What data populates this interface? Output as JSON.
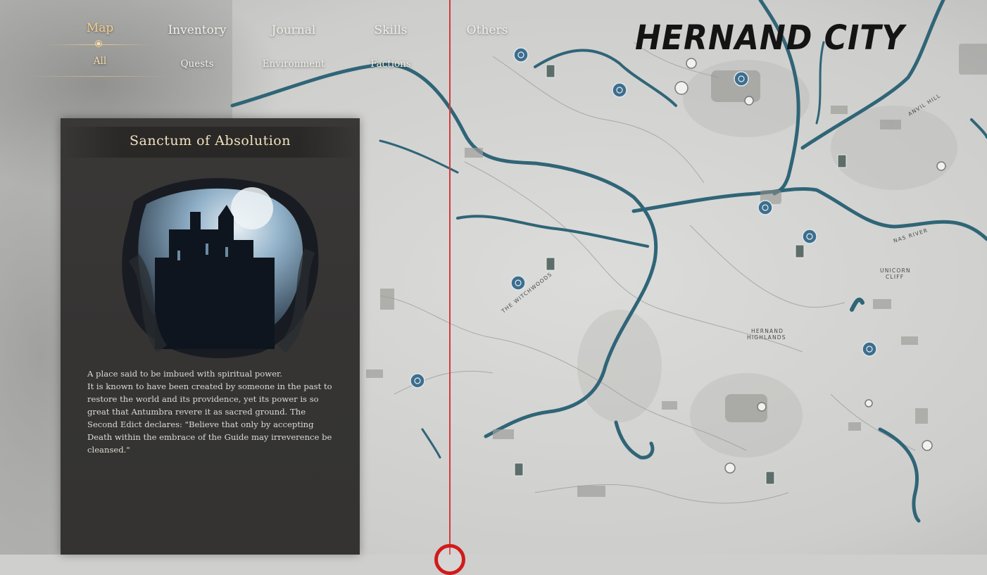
{
  "nav": {
    "tabs": [
      {
        "label": "Map",
        "active": true
      },
      {
        "label": "Inventory",
        "active": false
      },
      {
        "label": "Journal",
        "active": false
      },
      {
        "label": "Skills",
        "active": false
      },
      {
        "label": "Others",
        "active": false
      }
    ],
    "subtabs": [
      {
        "label": "All",
        "active": true
      },
      {
        "label": "Quests",
        "active": false
      },
      {
        "label": "Environment",
        "active": false
      },
      {
        "label": "Factions",
        "active": false
      }
    ]
  },
  "region": {
    "name": "HERNAND CITY"
  },
  "location_panel": {
    "title": "Sanctum of Absolution",
    "description": "A place said to be imbued with spiritual power.\nIt is known to have been created by someone in the past to restore the world and its providence, yet its power is so great that Antumbra revere it as sacred ground. The Second Edict declares: \"Believe that only by accepting Death within the embrace of the Guide may irreverence be cleansed.\""
  },
  "map_labels": {
    "witchwoods": "THE WITCHWOODS",
    "highlands_1": "HERNAND",
    "highlands_2": "HIGHLANDS",
    "unicorn_1": "UNICORN",
    "unicorn_2": "CLIFF",
    "nas_river": "NAS RIVER",
    "anvil_hill": "ANVIL HILL"
  },
  "icons": {
    "waypoint": "spiral-waypoint-icon",
    "shrine": "banner-shrine-icon",
    "point_of_interest": "circle-poi-icon"
  },
  "colors": {
    "accent": "#f0cf8e",
    "river": "#2f6577",
    "waypoint": "#3d6e8e",
    "divider": "#d23a3a",
    "marker": "#d11b1b"
  }
}
